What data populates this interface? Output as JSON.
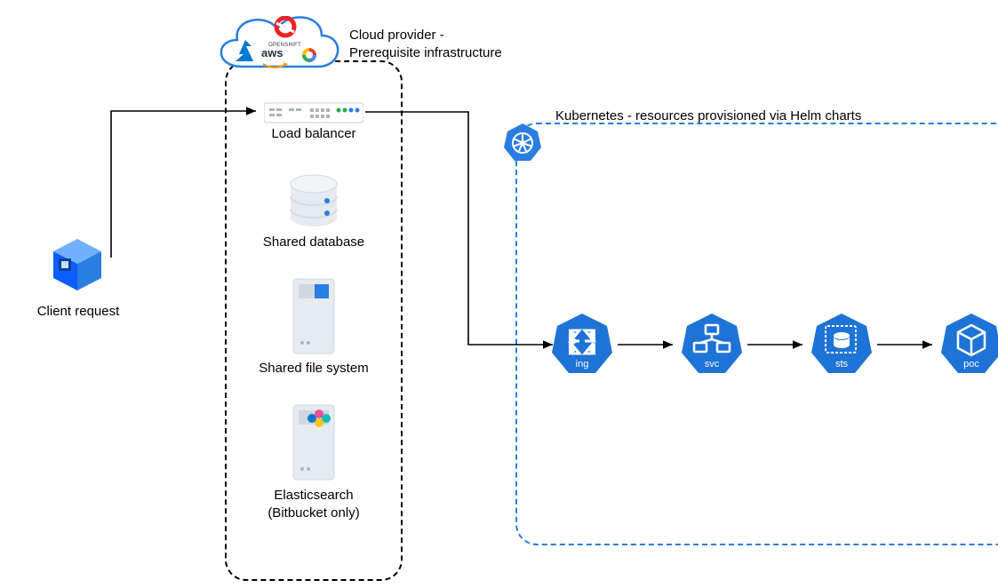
{
  "labels": {
    "cloud_provider": "Cloud provider -\nPrerequisite infrastructure",
    "client_request": "Client request",
    "load_balancer": "Load balancer",
    "shared_database": "Shared database",
    "shared_file_system": "Shared file system",
    "elasticsearch": "Elasticsearch\n(Bitbucket only)",
    "kubernetes": "Kubernetes - resources provisioned via Helm charts"
  },
  "k8s_nodes": {
    "ing": "ing",
    "svc": "svc",
    "sts": "sts",
    "pod": "poc"
  },
  "cloud_logos": {
    "azure": "Azure",
    "openshift": "OPENSHIFT",
    "aws": "aws",
    "gcp": "Google Cloud"
  }
}
